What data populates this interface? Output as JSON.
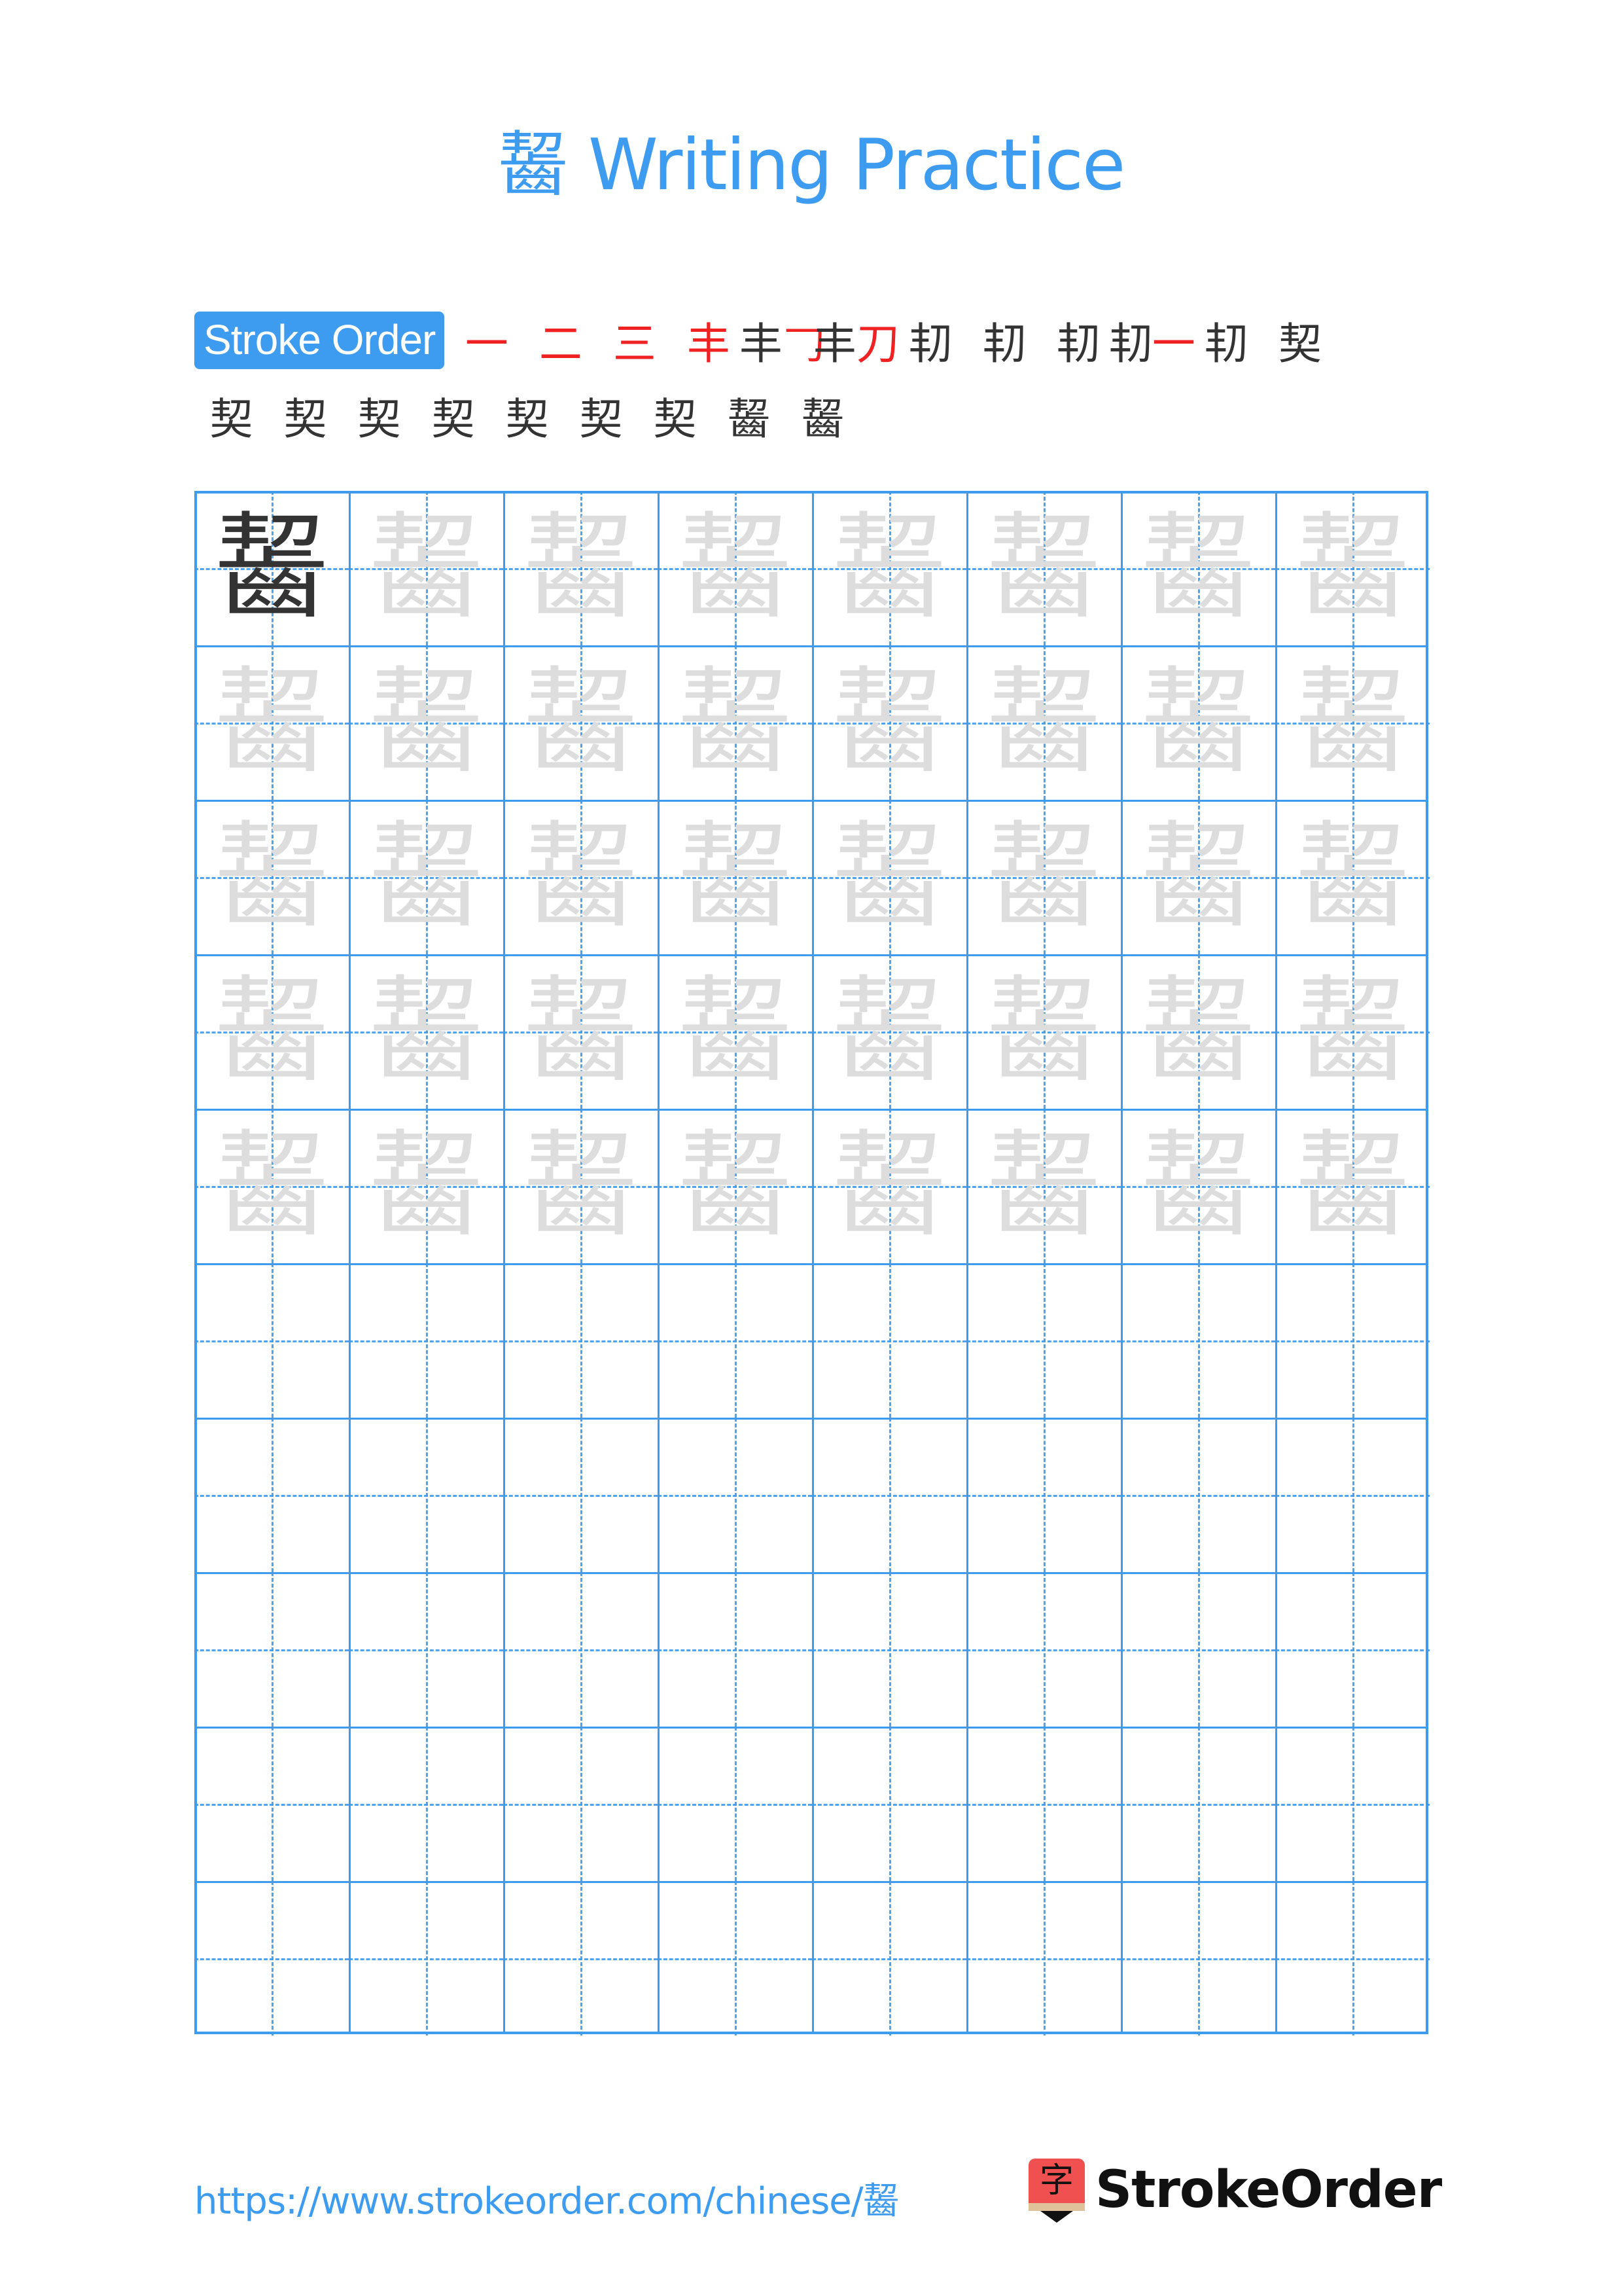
{
  "title": "齧 Writing Practice",
  "character": "齧",
  "stroke_order": {
    "label": "Stroke Order",
    "total_strokes": 21,
    "row1": [
      {
        "step": 1,
        "base": "",
        "new": "一"
      },
      {
        "step": 2,
        "base": "",
        "new": "二"
      },
      {
        "step": 3,
        "base": "",
        "new": "三"
      },
      {
        "step": 4,
        "base": "",
        "new": "丰"
      },
      {
        "step": 5,
        "base": "丰",
        "new": "𠃌"
      },
      {
        "step": 6,
        "base": "丰",
        "new": "刀"
      },
      {
        "step": 7,
        "base": "㓞",
        "new": ""
      },
      {
        "step": 8,
        "base": "㓞",
        "new": ""
      },
      {
        "step": 9,
        "base": "㓞",
        "new": ""
      },
      {
        "step": 10,
        "base": "㓞",
        "new": "一"
      },
      {
        "step": 11,
        "base": "㓞",
        "new": ""
      },
      {
        "step": 12,
        "base": "契",
        "new": ""
      }
    ],
    "row2": [
      {
        "step": 13,
        "base": "契",
        "new": ""
      },
      {
        "step": 14,
        "base": "契",
        "new": ""
      },
      {
        "step": 15,
        "base": "契",
        "new": ""
      },
      {
        "step": 16,
        "base": "契",
        "new": ""
      },
      {
        "step": 17,
        "base": "契",
        "new": ""
      },
      {
        "step": 18,
        "base": "契",
        "new": ""
      },
      {
        "step": 19,
        "base": "契",
        "new": ""
      },
      {
        "step": 20,
        "base": "齧",
        "new": ""
      },
      {
        "step": 21,
        "base": "齧",
        "new": ""
      }
    ]
  },
  "grid": {
    "columns": 8,
    "rows": 10,
    "traced_rows": 5,
    "model_color": "#333333",
    "trace_color": "#dddddd",
    "line_color": "#3d9bf0"
  },
  "footer": {
    "url": "https://www.strokeorder.com/chinese/齧",
    "logo_glyph": "字",
    "brand": "StrokeOrder"
  }
}
